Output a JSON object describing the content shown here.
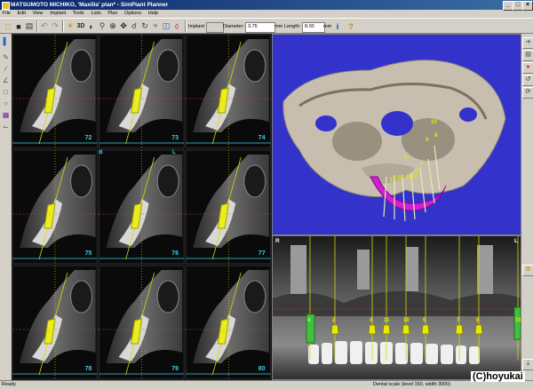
{
  "window": {
    "title": "MATSUMOTO MICHIKO, 'Maxilla' plan* - SimPlant Planner",
    "buttons": [
      "_",
      "□",
      "×"
    ]
  },
  "menu": [
    "File",
    "Edit",
    "View",
    "Implant",
    "Tools",
    "Lists",
    "Plan",
    "Options",
    "Help"
  ],
  "toolbar": {
    "implant_label": "Implant",
    "diameter_label": "Diameter:",
    "diameter_value": "3.75",
    "diameter_unit": "mm",
    "length_label": "Length:",
    "length_value": "8.00",
    "length_unit": "mm",
    "threed_label": "3D"
  },
  "slices": [
    "72",
    "73",
    "74",
    "75",
    "76",
    "77",
    "78",
    "79",
    "80"
  ],
  "slice_markers": {
    "b": "B",
    "l": "L"
  },
  "slice_implant_labels": [
    "9",
    "9",
    "9",
    "11",
    "11",
    "11",
    "11",
    "8",
    "11"
  ],
  "view3d": {
    "implant_labels": [
      "10",
      "9",
      "8",
      "4",
      "6",
      "7",
      "10",
      "11",
      "12",
      "14"
    ]
  },
  "panoramic": {
    "left_marker": "R",
    "right_marker": "L",
    "implant_labels": [
      "4",
      "2",
      "4",
      "11",
      "10",
      "6",
      "7",
      "8",
      "10"
    ]
  },
  "status": {
    "left": "Ready",
    "scale": "Dental scale (level 150, width 3000)",
    "watermark": "(C)hoyukai"
  },
  "colors": {
    "view3d_bg": "#3333cc",
    "implant_yellow": "#e8e800",
    "slice_number": "#39d0e8",
    "gum_magenta": "#d020d0"
  }
}
